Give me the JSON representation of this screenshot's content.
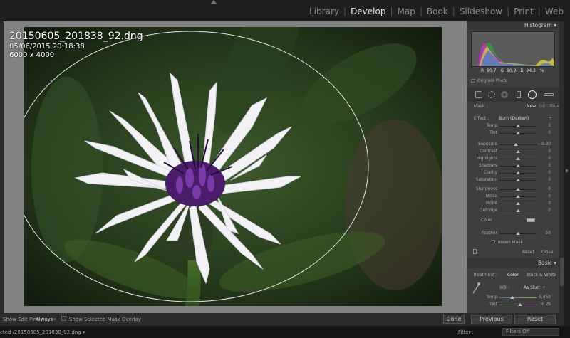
{
  "modules": [
    "Library",
    "Develop",
    "Map",
    "Book",
    "Slideshow",
    "Print",
    "Web"
  ],
  "active_module": "Develop",
  "image_info": {
    "filename": "20150605_201838_92.dng",
    "datetime": "05/06/2015 20:18:38",
    "dimensions": "6000 x 4000"
  },
  "histogram": {
    "title": "Histogram",
    "r_label": "R",
    "r_value": "90.7",
    "g_label": "G",
    "g_value": "90.9",
    "b_label": "B",
    "b_value": "94.3",
    "pct": "%",
    "original_photo": "Original Photo"
  },
  "mask_panel": {
    "mask_label": "Mask :",
    "new": "New",
    "edit": "Edit",
    "brush": "Brush",
    "effect_label": "Effect :",
    "effect_value": "Burn (Darken)",
    "effect_dd": "÷",
    "sliders_a": [
      {
        "name": "Temp",
        "value": "0",
        "pos": 0.5
      },
      {
        "name": "Tint",
        "value": "0",
        "pos": 0.5
      }
    ],
    "sliders_b": [
      {
        "name": "Exposure",
        "value": "– 0.30",
        "pos": 0.44
      },
      {
        "name": "Contrast",
        "value": "0",
        "pos": 0.5
      },
      {
        "name": "Highlights",
        "value": "0",
        "pos": 0.5
      },
      {
        "name": "Shadows",
        "value": "0",
        "pos": 0.5
      },
      {
        "name": "Clarity",
        "value": "0",
        "pos": 0.5
      },
      {
        "name": "Saturation",
        "value": "0",
        "pos": 0.5
      }
    ],
    "sliders_c": [
      {
        "name": "Sharpness",
        "value": "0",
        "pos": 0.5
      },
      {
        "name": "Noise",
        "value": "0",
        "pos": 0.5
      },
      {
        "name": "Moiré",
        "value": "0",
        "pos": 0.5
      },
      {
        "name": "Defringe",
        "value": "0",
        "pos": 0.5
      }
    ],
    "color_label": "Color",
    "feather_label": "Feather",
    "feather_value": "50",
    "feather_pos": 0.5,
    "invert_mask": "Invert Mask",
    "reset": "Reset",
    "close": "Close"
  },
  "basic_panel": {
    "title": "Basic",
    "treatment_label": "Treatment :",
    "color": "Color",
    "bw": "Black & White",
    "wb_label": "WB :",
    "wb_value": "As Shot",
    "wb_dd": "÷",
    "temp": {
      "name": "Temp",
      "value": "5,450",
      "pos": 0.35
    },
    "tint": {
      "name": "Tint",
      "value": "+ 26",
      "pos": 0.55
    }
  },
  "toolbar": {
    "show_edit_pins": "Show Edit Pins :",
    "always": "Always",
    "always_dd": "÷",
    "show_mask_overlay": "Show Selected Mask Overlay",
    "done": "Done"
  },
  "buttons": {
    "previous": "Previous",
    "reset": "Reset"
  },
  "filmstrip": {
    "path": "cted /20150605_201838_92.dng",
    "path_dd": "▾",
    "filter_label": "Filter :",
    "filter_value": "Filters Off"
  }
}
